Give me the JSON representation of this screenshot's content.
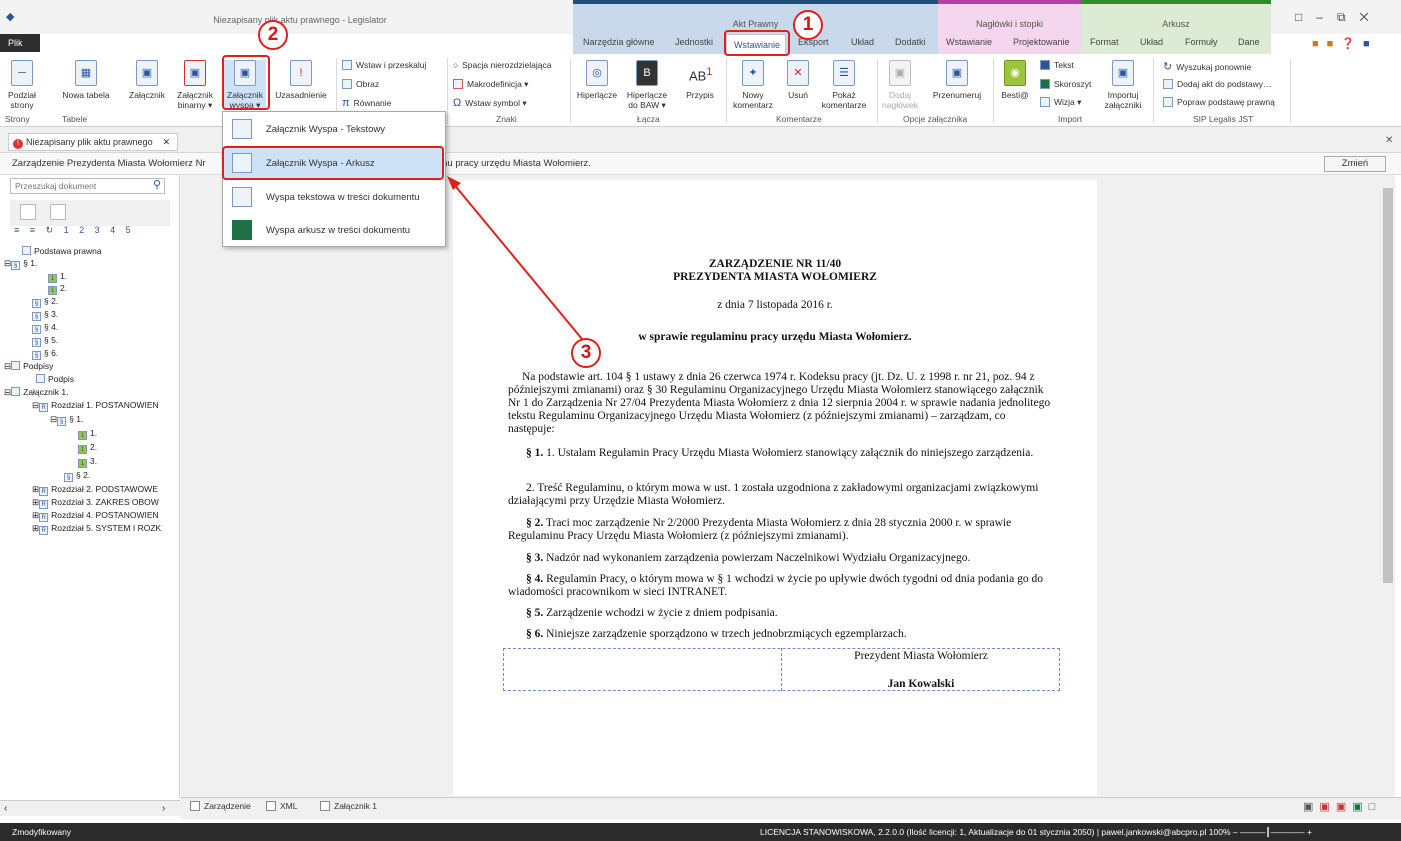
{
  "app": {
    "title": "Niezapisany plik aktu prawnego - Legislator",
    "window_controls": [
      "□",
      "–",
      "⧉",
      "✕"
    ]
  },
  "context_tabs": {
    "akt": "Akt Prawny",
    "nagl": "Nagłówki i stopki",
    "ark": "Arkusz"
  },
  "tabs": {
    "plik": "Plik",
    "narzedzia": "Narzędzia główne",
    "jednostki": "Jednostki",
    "wstawianie": "Wstawianie",
    "eksport": "Eksport",
    "uklad": "Układ",
    "dodatki": "Dodatki",
    "wstawianie2": "Wstawianie",
    "projektowanie": "Projektowanie",
    "format": "Format",
    "uklad2": "Układ",
    "formuly": "Formuły",
    "dane": "Dane"
  },
  "ribbon": {
    "podzial": "Podział",
    "strony": "strony",
    "nowa_tabela": "Nowa tabela",
    "zalacznik": "Załącznik",
    "zal_binarny1": "Załącznik",
    "zal_binarny2": "binarny ▾",
    "zal_wyspa1": "Załącznik",
    "zal_wyspa2": "wyspa ▾",
    "uzasadnienie": "Uzasadnienie",
    "wstaw_przeskaluj": "Wstaw i przeskaluj",
    "obraz": "Obraz",
    "rownanie": "Równanie",
    "spacja": "Spacja nierozdzielająca",
    "makrodefinicja": "Makrodefinicja ▾",
    "wstaw_symbol": "Wstaw symbol ▾",
    "hiperlacze": "Hiperlącze",
    "hiperlacze_baw1": "Hiperlącze",
    "hiperlacze_baw2": "do BAW ▾",
    "przypis": "Przypis",
    "nowy_kom1": "Nowy",
    "nowy_kom2": "komentarz",
    "usun": "Usuń",
    "pokaz1": "Pokaż",
    "pokaz2": "komentarze",
    "dodaj_nagl1": "Dodaj",
    "dodaj_nagl2": "nagłówek",
    "przenumeruj": "Przenumeruj",
    "bestia": "Besti@",
    "tekst": "Tekst",
    "skoroszyt": "Skoroszyt",
    "wizja": "Wizja ▾",
    "importuj1": "Importuj",
    "importuj2": "załączniki",
    "wyszukaj": "Wyszukaj ponownie",
    "dodaj_akt": "Dodaj akt do podstawy…",
    "popraw": "Popraw podstawę prawną"
  },
  "groups": {
    "strony": "Strony",
    "tabele": "Tabele",
    "znaki": "Znaki",
    "lacza": "Łącza",
    "komentarze": "Komentarze",
    "opcje": "Opcje załącznika",
    "import": "Import",
    "sip": "SIP Legalis JST"
  },
  "dropdown": [
    "Załącznik Wyspa - Tekstowy",
    "Załącznik Wyspa - Arkusz",
    "Wyspa tekstowa w treści dokumentu",
    "Wyspa arkusz w treści dokumentu"
  ],
  "doc_tab": "Niezapisany plik aktu prawnego",
  "info_line": {
    "left": "Zarządzenie Prezydenta Miasta Wołomierz Nr",
    "right": "inu pracy urzędu Miasta Wołomierz.",
    "button": "Zmień"
  },
  "left_panel": {
    "search_placeholder": "Przeszukaj dokument",
    "levels": "1 2 3 4 5",
    "tree": [
      "Podstawa prawna",
      "§ 1.",
      "1.",
      "2.",
      "§ 2.",
      "§ 3.",
      "§ 4.",
      "§ 5.",
      "§ 6.",
      "Podpisy",
      "Podpis",
      "Załącznik 1.",
      "Rozdział 1. POSTANOWIEN",
      "§ 1.",
      "1.",
      "2.",
      "3.",
      "§ 2.",
      "Rozdział 2. PODSTAWOWE",
      "Rozdział 3. ZAKRES OBOW",
      "Rozdział 4. POSTANOWIEN",
      "Rozdział 5. SYSTEM I ROZK"
    ]
  },
  "document": {
    "title1": "ZARZĄDZENIE NR 11/40",
    "title2": "PREZYDENTA MIASTA WOŁOMIERZ",
    "date": "z dnia 7 listopada 2016 r.",
    "subject": "w sprawie regulaminu pracy urzędu Miasta Wołomierz.",
    "p1": "Na podstawie art. 104 § 1 ustawy z dnia 26 czerwca 1974 r. Kodeksu pracy (jt. Dz. U. z 1998 r. nr 21, poz. 94 z późniejszymi zmianami) oraz § 30 Regulaminu Organizacyjnego Urzędu Miasta Wołomierz stanowiącego załącznik Nr 1 do Zarządzenia Nr 27/04 Prezydenta Miasta Wołomierz z dnia 12 sierpnia 2004 r. w sprawie nadania jednolitego tekstu Regulaminu Organizacyjnego Urzędu Miasta Wołomierz (z późniejszymi zmianami) – zarządzam, co następuje:",
    "s1_label": "§ 1.",
    "s1": " 1. Ustalam Regulamin Pracy Urzędu Miasta Wołomierz stanowiący załącznik do niniejszego zarządzenia.",
    "s1_2": "2. Treść Regulaminu, o którym mowa w ust. 1 została uzgodniona z zakładowymi organizacjami związkowymi działającymi przy Urzędzie Miasta Wołomierz.",
    "s2_label": "§ 2.",
    "s2": " Traci moc zarządzenie Nr 2/2000 Prezydenta Miasta Wołomierz z dnia 28 stycznia 2000 r. w sprawie Regulaminu Pracy Urzędu Miasta Wołomierz (z późniejszymi zmianami).",
    "s3_label": "§ 3.",
    "s3": " Nadzór nad wykonaniem zarządzenia powierzam Naczelnikowi Wydziału Organizacyjnego.",
    "s4_label": "§ 4.",
    "s4": " Regulamin Pracy, o którym mowa w § 1 wchodzi w życie po upływie dwóch tygodni od dnia podania go do wiadomości pracownikom w sieci INTRANET.",
    "s5_label": "§ 5.",
    "s5": " Zarządzenie wchodzi w życie z dniem podpisania.",
    "s6_label": "§ 6.",
    "s6": " Niniejsze zarządzenie sporządzono w trzech jednobrzmiących egzemplarzach.",
    "sig_title": "Prezydent Miasta Wołomierz",
    "sig_name": "Jan Kowalski"
  },
  "bottom_tabs": [
    "Zarządzenie",
    "XML",
    "Załącznik 1"
  ],
  "status": {
    "left": "Zmodyfikowany",
    "right": "LICENCJA STANOWISKOWA, 2.2.0.0 (Ilość licencji: 1, Aktualizacje do 01 stycznia 2050)  |  pawel.jankowski@abcpro.pl   100%  – ———┃————  +"
  },
  "annotations": [
    "1",
    "2",
    "3"
  ],
  "colors": {
    "accent": "#2b579a",
    "annotation": "#e0201a",
    "akt_prawny": "#c9d8ea",
    "naglowki": "#f4d7ee",
    "arkusz": "#dcecd4"
  }
}
